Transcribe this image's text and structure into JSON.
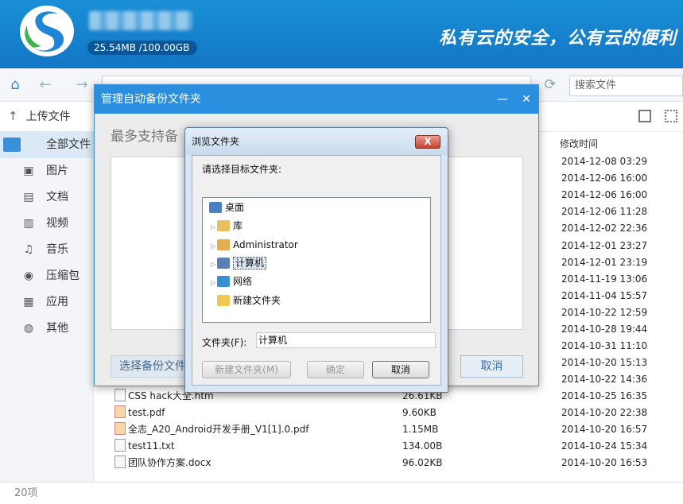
{
  "app": {
    "quota_text": "25.54MB /100.00GB",
    "slogan": "私有云的安全，公有云的便利"
  },
  "nav": {
    "search_placeholder": "搜索文件"
  },
  "toolbar": {
    "upload_label": "上传文件"
  },
  "sidebar": {
    "items": [
      {
        "label": "全部文件",
        "icon": "folder-icon",
        "active": true
      },
      {
        "label": "图片",
        "icon": "image-icon"
      },
      {
        "label": "文档",
        "icon": "document-icon"
      },
      {
        "label": "视频",
        "icon": "video-icon"
      },
      {
        "label": "音乐",
        "icon": "music-icon"
      },
      {
        "label": "压缩包",
        "icon": "archive-icon"
      },
      {
        "label": "应用",
        "icon": "apps-icon"
      },
      {
        "label": "其他",
        "icon": "other-icon"
      }
    ]
  },
  "filelist": {
    "date_header": "修改时间",
    "dates_top": [
      "2014-12-08 03:29",
      "2014-12-06 16:00",
      "2014-12-06 16:00",
      "2014-12-06 11:28",
      "2014-12-02 22:36",
      "2014-12-01 23:27",
      "2014-12-01 23:19",
      "2014-11-19 13:06",
      "2014-11-04 15:57",
      "2014-10-22 12:59",
      "2014-10-28 19:44",
      "2014-10-31 11:10",
      "2014-10-20 15:13",
      "2014-10-22 14:36"
    ],
    "files": [
      {
        "name": "CSS hack大全.htm",
        "size": "26.61KB",
        "date": "2014-10-25 16:35",
        "type": "doc"
      },
      {
        "name": "test.pdf",
        "size": "9.60KB",
        "date": "2014-10-20 22:38",
        "type": "pdf"
      },
      {
        "name": "全志_A20_Android开发手册_V1[1].0.pdf",
        "size": "1.15MB",
        "date": "2014-10-20 16:57",
        "type": "pdf"
      },
      {
        "name": "test11.txt",
        "size": "134.00B",
        "date": "2014-10-24 15:34",
        "type": "doc"
      },
      {
        "name": "团队协作方案.docx",
        "size": "96.02KB",
        "date": "2014-10-20 16:53",
        "type": "doc"
      }
    ]
  },
  "status": {
    "count": "20项"
  },
  "backup_dialog": {
    "title": "管理自动备份文件夹",
    "hint": "最多支持备",
    "pick_label": "选择备份文件",
    "cancel_label": "取消"
  },
  "browse_dialog": {
    "title": "浏览文件夹",
    "close": "X",
    "prompt": "请选择目标文件夹:",
    "tree": [
      {
        "label": "桌面",
        "icon": "desktop-icon",
        "expander": false,
        "indent": 0
      },
      {
        "label": "库",
        "icon": "library-icon",
        "expander": true,
        "indent": 1
      },
      {
        "label": "Administrator",
        "icon": "user-folder-icon",
        "expander": true,
        "indent": 1
      },
      {
        "label": "计算机",
        "icon": "computer-icon",
        "expander": true,
        "indent": 1,
        "selected": true
      },
      {
        "label": "网络",
        "icon": "network-icon",
        "expander": true,
        "indent": 1
      },
      {
        "label": "新建文件夹",
        "icon": "folder-icon",
        "expander": false,
        "indent": 1
      }
    ],
    "folder_label": "文件夹(F):",
    "folder_value": "计算机",
    "new_folder_label": "新建文件夹(M)",
    "ok_label": "确定",
    "cancel_label": "取消"
  }
}
